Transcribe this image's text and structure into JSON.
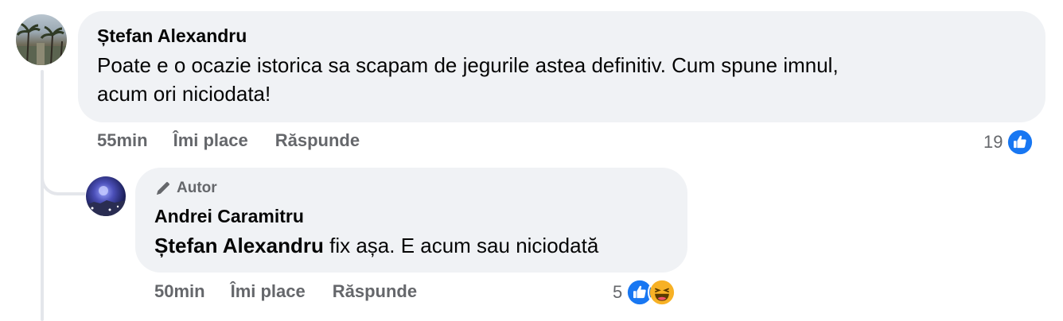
{
  "comments": [
    {
      "author": "Ștefan Alexandru",
      "text": "Poate e o ocazie istorica sa scapam de jegurile astea definitiv. Cum spune imnul,",
      "text_line2": "acum ori niciodata!",
      "time": "55min",
      "like_label": "Îmi place",
      "reply_label": "Răspunde",
      "reaction_count": "19",
      "reactions": [
        "like-icon"
      ],
      "avatar_icon": "palm-trees-avatar"
    },
    {
      "badge": "Autor",
      "badge_icon": "pencil-icon",
      "author": "Andrei Caramitru",
      "mention": "Ștefan Alexandru",
      "text": " fix așa. E acum sau niciodată",
      "time": "50min",
      "like_label": "Îmi place",
      "reply_label": "Răspunde",
      "reaction_count": "5",
      "reactions": [
        "like-icon",
        "haha-icon"
      ],
      "avatar_icon": "night-city-avatar"
    }
  ],
  "colors": {
    "bubble": "#f0f2f5",
    "meta_text": "#65676b",
    "like_blue": "#1877f2",
    "haha_yellow": "#f7b125",
    "thread_line": "#e4e6eb"
  }
}
